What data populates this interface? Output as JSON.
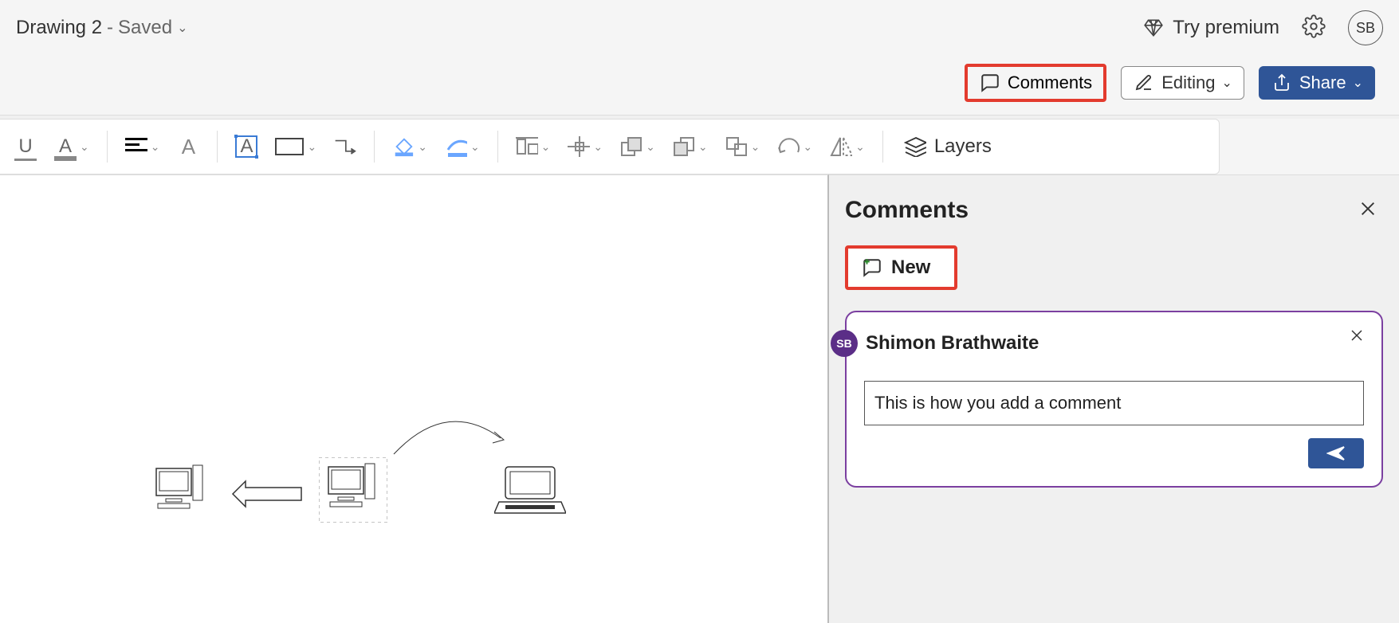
{
  "header": {
    "doc_name": "Drawing 2",
    "doc_status_sep": "-",
    "doc_status": "Saved",
    "try_premium": "Try premium",
    "avatar_initials": "SB"
  },
  "actions": {
    "comments": "Comments",
    "editing": "Editing",
    "share": "Share"
  },
  "toolbar": {
    "layers": "Layers",
    "underline_letter": "U",
    "fontcolor_letter": "A",
    "fontsize_letter": "A",
    "textbox_letter": "A"
  },
  "comments_panel": {
    "title": "Comments",
    "new_label": "New",
    "commenter": "Shimon Brathwaite",
    "commenter_initials": "SB",
    "input_value": "This is how you add a comment"
  }
}
